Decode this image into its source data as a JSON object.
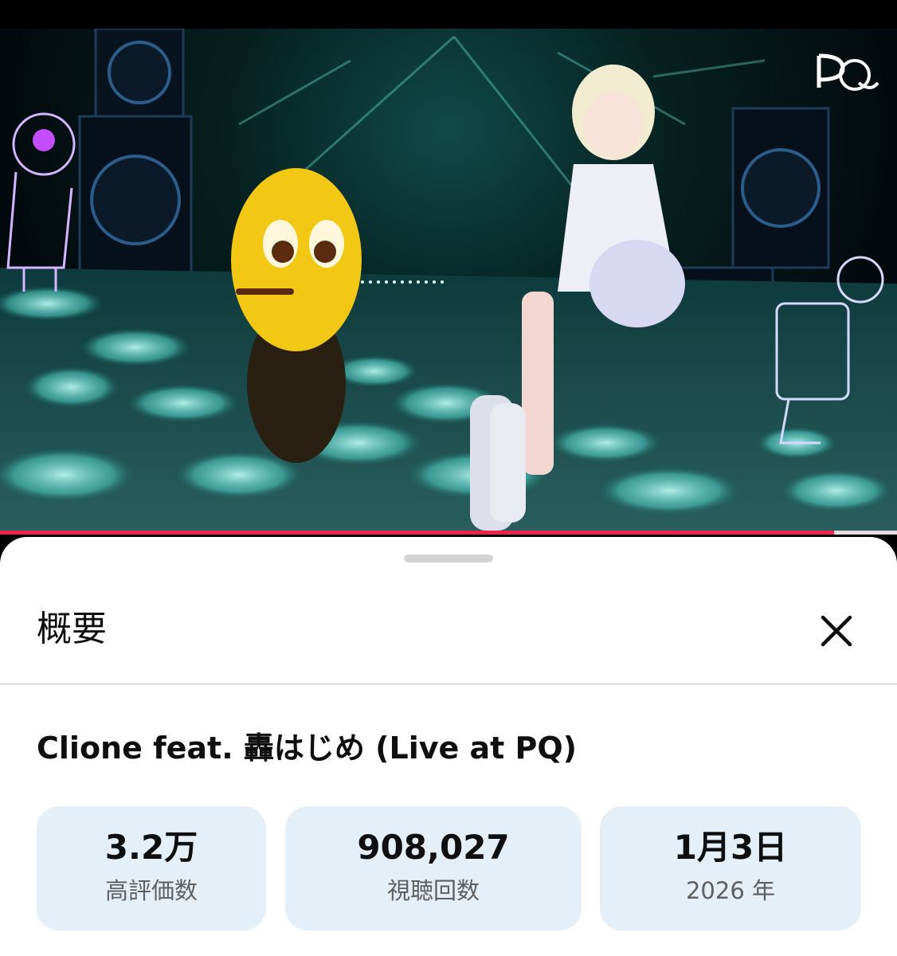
{
  "player": {
    "watermark_icon": "pq-logo",
    "progress_fraction": 0.93,
    "progress_color": "#f0234f"
  },
  "description_sheet": {
    "header_title": "概要",
    "close_icon": "close-icon"
  },
  "video": {
    "title": "Clione feat. 轟はじめ (Live at PQ)"
  },
  "stats": {
    "likes": {
      "value": "3.2万",
      "label": "高評価数"
    },
    "views": {
      "value": "908,027",
      "label": "視聴回数"
    },
    "date": {
      "value": "1月3日",
      "label": "2026 年"
    }
  }
}
